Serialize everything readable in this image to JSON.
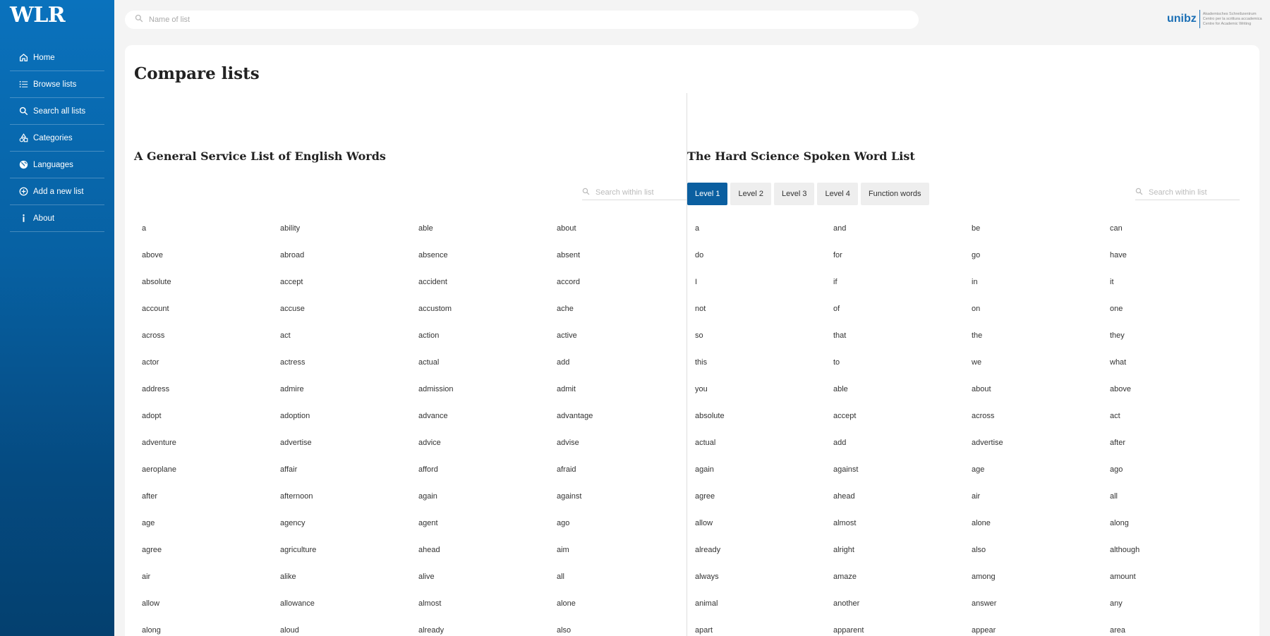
{
  "app": {
    "logo": "WLR"
  },
  "sidebar": {
    "items": [
      {
        "label": "Home",
        "icon": "home-icon"
      },
      {
        "label": "Browse lists",
        "icon": "list-icon"
      },
      {
        "label": "Search all lists",
        "icon": "search-icon"
      },
      {
        "label": "Categories",
        "icon": "shapes-icon"
      },
      {
        "label": "Languages",
        "icon": "globe-icon"
      },
      {
        "label": "Add a new list",
        "icon": "plus-circle-icon"
      },
      {
        "label": "About",
        "icon": "info-icon"
      }
    ]
  },
  "topbar": {
    "search_placeholder": "Name of list",
    "brand": {
      "name": "unibz",
      "lines": [
        "Akademisches Schreibzentrum",
        "Centro per la scrittura accademica",
        "Centre for Academic Writing"
      ]
    }
  },
  "main": {
    "title": "Compare lists",
    "left": {
      "title": "A General Service List of English Words",
      "search_placeholder": "Search within list",
      "words": [
        "a",
        "ability",
        "able",
        "about",
        "above",
        "abroad",
        "absence",
        "absent",
        "absolute",
        "accept",
        "accident",
        "accord",
        "account",
        "accuse",
        "accustom",
        "ache",
        "across",
        "act",
        "action",
        "active",
        "actor",
        "actress",
        "actual",
        "add",
        "address",
        "admire",
        "admission",
        "admit",
        "adopt",
        "adoption",
        "advance",
        "advantage",
        "adventure",
        "advertise",
        "advice",
        "advise",
        "aeroplane",
        "affair",
        "afford",
        "afraid",
        "after",
        "afternoon",
        "again",
        "against",
        "age",
        "agency",
        "agent",
        "ago",
        "agree",
        "agriculture",
        "ahead",
        "aim",
        "air",
        "alike",
        "alive",
        "all",
        "allow",
        "allowance",
        "almost",
        "alone",
        "along",
        "aloud",
        "already",
        "also"
      ]
    },
    "right": {
      "title": "The Hard Science Spoken Word List",
      "search_placeholder": "Search within list",
      "levels": [
        "Level 1",
        "Level 2",
        "Level 3",
        "Level 4",
        "Function words"
      ],
      "active_level": "Level 1",
      "words": [
        "a",
        "and",
        "be",
        "can",
        "do",
        "for",
        "go",
        "have",
        "I",
        "if",
        "in",
        "it",
        "not",
        "of",
        "on",
        "one",
        "so",
        "that",
        "the",
        "they",
        "this",
        "to",
        "we",
        "what",
        "you",
        "able",
        "about",
        "above",
        "absolute",
        "accept",
        "across",
        "act",
        "actual",
        "add",
        "advertise",
        "after",
        "again",
        "against",
        "age",
        "ago",
        "agree",
        "ahead",
        "air",
        "all",
        "allow",
        "almost",
        "alone",
        "along",
        "already",
        "alright",
        "also",
        "although",
        "always",
        "amaze",
        "among",
        "amount",
        "animal",
        "another",
        "answer",
        "any",
        "apart",
        "apparent",
        "appear",
        "area"
      ]
    }
  },
  "colors": {
    "primary": "#0b5fa0",
    "sidebar_top": "#0a72bd",
    "sidebar_bottom": "#04406f"
  }
}
